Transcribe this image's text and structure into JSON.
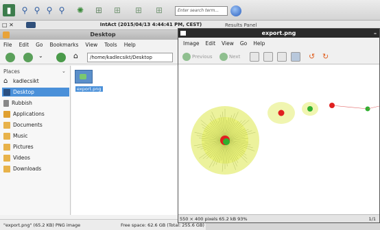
{
  "top_toolbar": {
    "search_placeholder": "Enter search term..."
  },
  "intact_window": {
    "title": "IntAct (2015/04/13 4:44:41 PM, CEST)",
    "results_panel_label": "Results Panel"
  },
  "file_manager": {
    "title": "Desktop",
    "menu": [
      "File",
      "Edit",
      "Go",
      "Bookmarks",
      "View",
      "Tools",
      "Help"
    ],
    "path": "/home/kadlecsikt/Desktop",
    "places_header": "Places",
    "places": [
      {
        "label": "kadlecsikt",
        "icon": "home-icon",
        "active": false
      },
      {
        "label": "Desktop",
        "icon": "desktop-icon",
        "active": true
      },
      {
        "label": "Rubbish",
        "icon": "trash-icon",
        "active": false
      },
      {
        "label": "Applications",
        "icon": "applications-icon",
        "active": false
      },
      {
        "label": "Documents",
        "icon": "folder-icon",
        "active": false
      },
      {
        "label": "Music",
        "icon": "folder-icon",
        "active": false
      },
      {
        "label": "Pictures",
        "icon": "folder-icon",
        "active": false
      },
      {
        "label": "Videos",
        "icon": "folder-icon",
        "active": false
      },
      {
        "label": "Downloads",
        "icon": "folder-icon",
        "active": false
      }
    ],
    "file": {
      "label": "export.png"
    },
    "status_left": "\"export.png\" (65.2 KB) PNG image",
    "status_right": "Free space: 62.6 GB (Total: 255.6 GB)"
  },
  "viewer": {
    "title": "export.png",
    "menu": [
      "Image",
      "Edit",
      "View",
      "Go",
      "Help"
    ],
    "previous_label": "Previous",
    "next_label": "Next",
    "status": "550 × 400 pixels  65.2 kB   93%",
    "page_count": "1/1"
  },
  "colors": {
    "selection": "#4a90d9",
    "node_hub": "#e02020",
    "node_green": "#30b030",
    "node_halo": "#d8e840"
  }
}
